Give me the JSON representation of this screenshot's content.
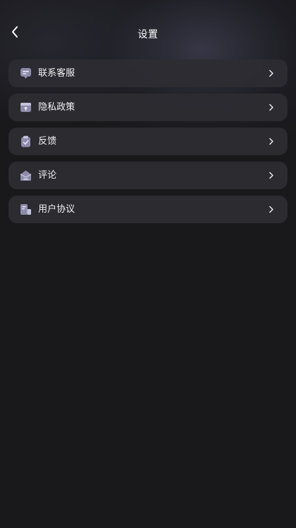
{
  "header": {
    "title": "设置",
    "back_icon": "chevron-left-icon"
  },
  "menu": {
    "items": [
      {
        "label": "联系客服",
        "icon": "customer-service-icon"
      },
      {
        "label": "隐私政策",
        "icon": "privacy-icon"
      },
      {
        "label": "反馈",
        "icon": "feedback-icon"
      },
      {
        "label": "评论",
        "icon": "comment-icon"
      },
      {
        "label": "用户协议",
        "icon": "agreement-icon"
      }
    ],
    "chevron_icon": "chevron-right-icon"
  },
  "colors": {
    "background": "#19191c",
    "item_background": "#2c2c32",
    "icon_primary": "#8e8cab",
    "icon_secondary": "#c5c3dc",
    "text": "#f2f2f5"
  }
}
